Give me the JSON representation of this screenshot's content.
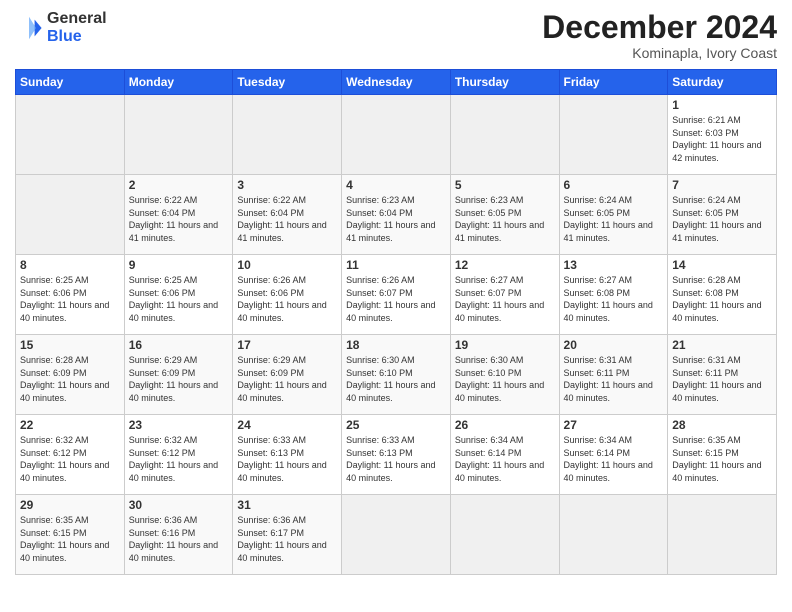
{
  "header": {
    "logo": {
      "general": "General",
      "blue": "Blue"
    },
    "title": "December 2024",
    "location": "Kominapla, Ivory Coast"
  },
  "calendar": {
    "days_of_week": [
      "Sunday",
      "Monday",
      "Tuesday",
      "Wednesday",
      "Thursday",
      "Friday",
      "Saturday"
    ],
    "weeks": [
      [
        {
          "day": "",
          "empty": true
        },
        {
          "day": "",
          "empty": true
        },
        {
          "day": "",
          "empty": true
        },
        {
          "day": "",
          "empty": true
        },
        {
          "day": "",
          "empty": true
        },
        {
          "day": "",
          "empty": true
        },
        {
          "day": "1",
          "sunrise": "Sunrise: 6:21 AM",
          "sunset": "Sunset: 6:03 PM",
          "daylight": "Daylight: 11 hours and 42 minutes."
        }
      ],
      [
        {
          "day": "2",
          "sunrise": "Sunrise: 6:22 AM",
          "sunset": "Sunset: 6:04 PM",
          "daylight": "Daylight: 11 hours and 41 minutes."
        },
        {
          "day": "3",
          "sunrise": "Sunrise: 6:22 AM",
          "sunset": "Sunset: 6:04 PM",
          "daylight": "Daylight: 11 hours and 41 minutes."
        },
        {
          "day": "4",
          "sunrise": "Sunrise: 6:23 AM",
          "sunset": "Sunset: 6:04 PM",
          "daylight": "Daylight: 11 hours and 41 minutes."
        },
        {
          "day": "5",
          "sunrise": "Sunrise: 6:23 AM",
          "sunset": "Sunset: 6:05 PM",
          "daylight": "Daylight: 11 hours and 41 minutes."
        },
        {
          "day": "6",
          "sunrise": "Sunrise: 6:24 AM",
          "sunset": "Sunset: 6:05 PM",
          "daylight": "Daylight: 11 hours and 41 minutes."
        },
        {
          "day": "7",
          "sunrise": "Sunrise: 6:24 AM",
          "sunset": "Sunset: 6:05 PM",
          "daylight": "Daylight: 11 hours and 41 minutes."
        }
      ],
      [
        {
          "day": "8",
          "sunrise": "Sunrise: 6:25 AM",
          "sunset": "Sunset: 6:06 PM",
          "daylight": "Daylight: 11 hours and 40 minutes."
        },
        {
          "day": "9",
          "sunrise": "Sunrise: 6:25 AM",
          "sunset": "Sunset: 6:06 PM",
          "daylight": "Daylight: 11 hours and 40 minutes."
        },
        {
          "day": "10",
          "sunrise": "Sunrise: 6:26 AM",
          "sunset": "Sunset: 6:06 PM",
          "daylight": "Daylight: 11 hours and 40 minutes."
        },
        {
          "day": "11",
          "sunrise": "Sunrise: 6:26 AM",
          "sunset": "Sunset: 6:07 PM",
          "daylight": "Daylight: 11 hours and 40 minutes."
        },
        {
          "day": "12",
          "sunrise": "Sunrise: 6:27 AM",
          "sunset": "Sunset: 6:07 PM",
          "daylight": "Daylight: 11 hours and 40 minutes."
        },
        {
          "day": "13",
          "sunrise": "Sunrise: 6:27 AM",
          "sunset": "Sunset: 6:08 PM",
          "daylight": "Daylight: 11 hours and 40 minutes."
        },
        {
          "day": "14",
          "sunrise": "Sunrise: 6:28 AM",
          "sunset": "Sunset: 6:08 PM",
          "daylight": "Daylight: 11 hours and 40 minutes."
        }
      ],
      [
        {
          "day": "15",
          "sunrise": "Sunrise: 6:28 AM",
          "sunset": "Sunset: 6:09 PM",
          "daylight": "Daylight: 11 hours and 40 minutes."
        },
        {
          "day": "16",
          "sunrise": "Sunrise: 6:29 AM",
          "sunset": "Sunset: 6:09 PM",
          "daylight": "Daylight: 11 hours and 40 minutes."
        },
        {
          "day": "17",
          "sunrise": "Sunrise: 6:29 AM",
          "sunset": "Sunset: 6:09 PM",
          "daylight": "Daylight: 11 hours and 40 minutes."
        },
        {
          "day": "18",
          "sunrise": "Sunrise: 6:30 AM",
          "sunset": "Sunset: 6:10 PM",
          "daylight": "Daylight: 11 hours and 40 minutes."
        },
        {
          "day": "19",
          "sunrise": "Sunrise: 6:30 AM",
          "sunset": "Sunset: 6:10 PM",
          "daylight": "Daylight: 11 hours and 40 minutes."
        },
        {
          "day": "20",
          "sunrise": "Sunrise: 6:31 AM",
          "sunset": "Sunset: 6:11 PM",
          "daylight": "Daylight: 11 hours and 40 minutes."
        },
        {
          "day": "21",
          "sunrise": "Sunrise: 6:31 AM",
          "sunset": "Sunset: 6:11 PM",
          "daylight": "Daylight: 11 hours and 40 minutes."
        }
      ],
      [
        {
          "day": "22",
          "sunrise": "Sunrise: 6:32 AM",
          "sunset": "Sunset: 6:12 PM",
          "daylight": "Daylight: 11 hours and 40 minutes."
        },
        {
          "day": "23",
          "sunrise": "Sunrise: 6:32 AM",
          "sunset": "Sunset: 6:12 PM",
          "daylight": "Daylight: 11 hours and 40 minutes."
        },
        {
          "day": "24",
          "sunrise": "Sunrise: 6:33 AM",
          "sunset": "Sunset: 6:13 PM",
          "daylight": "Daylight: 11 hours and 40 minutes."
        },
        {
          "day": "25",
          "sunrise": "Sunrise: 6:33 AM",
          "sunset": "Sunset: 6:13 PM",
          "daylight": "Daylight: 11 hours and 40 minutes."
        },
        {
          "day": "26",
          "sunrise": "Sunrise: 6:34 AM",
          "sunset": "Sunset: 6:14 PM",
          "daylight": "Daylight: 11 hours and 40 minutes."
        },
        {
          "day": "27",
          "sunrise": "Sunrise: 6:34 AM",
          "sunset": "Sunset: 6:14 PM",
          "daylight": "Daylight: 11 hours and 40 minutes."
        },
        {
          "day": "28",
          "sunrise": "Sunrise: 6:35 AM",
          "sunset": "Sunset: 6:15 PM",
          "daylight": "Daylight: 11 hours and 40 minutes."
        }
      ],
      [
        {
          "day": "29",
          "sunrise": "Sunrise: 6:35 AM",
          "sunset": "Sunset: 6:15 PM",
          "daylight": "Daylight: 11 hours and 40 minutes."
        },
        {
          "day": "30",
          "sunrise": "Sunrise: 6:36 AM",
          "sunset": "Sunset: 6:16 PM",
          "daylight": "Daylight: 11 hours and 40 minutes."
        },
        {
          "day": "31",
          "sunrise": "Sunrise: 6:36 AM",
          "sunset": "Sunset: 6:17 PM",
          "daylight": "Daylight: 11 hours and 40 minutes."
        },
        {
          "day": "",
          "empty": true
        },
        {
          "day": "",
          "empty": true
        },
        {
          "day": "",
          "empty": true
        },
        {
          "day": "",
          "empty": true
        }
      ]
    ],
    "first_week": [
      {
        "day": "1",
        "sunrise": "Sunrise: 6:21 AM",
        "sunset": "Sunset: 6:03 PM",
        "daylight": "Daylight: 11 hours and 42 minutes."
      }
    ]
  }
}
